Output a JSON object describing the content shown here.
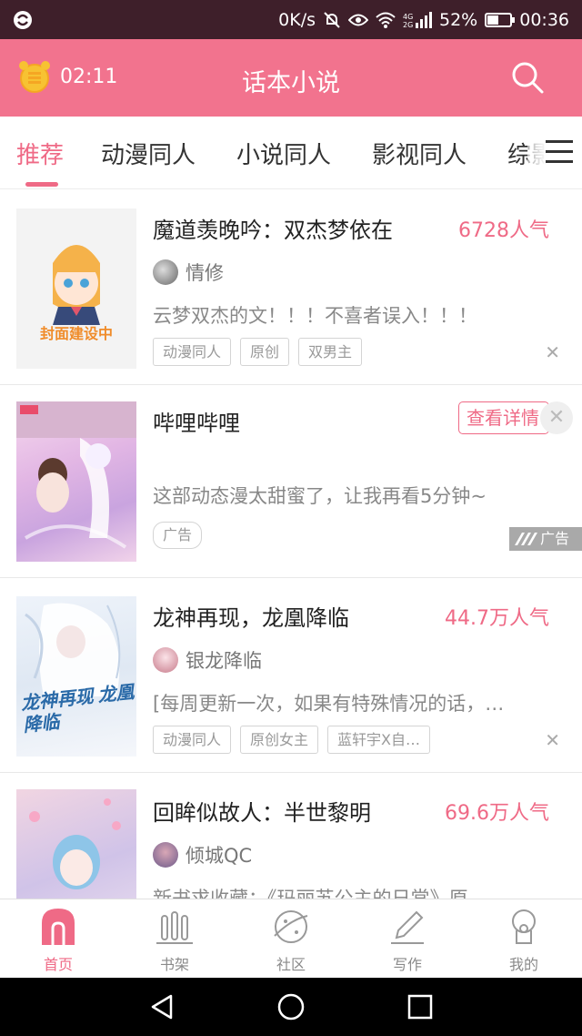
{
  "status_bar": {
    "speed": "0K/s",
    "network": "4G 2G",
    "battery": "52%",
    "battery_fraction": 0.52,
    "time": "00:36"
  },
  "header": {
    "timer": "02:11",
    "title": "话本小说"
  },
  "tabs": [
    {
      "label": "推荐",
      "active": true
    },
    {
      "label": "动漫同人",
      "active": false
    },
    {
      "label": "小说同人",
      "active": false
    },
    {
      "label": "影视同人",
      "active": false
    },
    {
      "label": "综影",
      "active": false
    }
  ],
  "feed": {
    "items": [
      {
        "title": "魔道羡晚吟：双杰梦依在",
        "popularity": "6728人气",
        "author": "情修",
        "description": "云梦双杰的文！！！不喜者误入！！！",
        "tags": [
          "动漫同人",
          "原创",
          "双男主"
        ],
        "cover_text": "封面建设中"
      },
      {
        "title": "哔哩哔哩",
        "ad_button": "查看详情",
        "description": "这部动态漫太甜蜜了，让我再看5分钟~",
        "ad_tag": "广告",
        "ad_mark": "广告"
      },
      {
        "title": "龙神再现，龙凰降临",
        "popularity": "44.7万人气",
        "author": "银龙降临",
        "description": "[每周更新一次，如果有特殊情况的话，…",
        "tags": [
          "动漫同人",
          "原创女主",
          "蓝轩宇X自…"
        ],
        "cover_text": "龙神再现 龙凰降临"
      },
      {
        "title": "回眸似故人：半世黎明",
        "popularity": "69.6万人气",
        "author": "倾城QC",
        "description": "新书求收藏：《玛丽苏公主的日常》原"
      }
    ]
  },
  "bottom_nav": [
    {
      "label": "首页",
      "icon": "home-icon",
      "active": true
    },
    {
      "label": "书架",
      "icon": "bookshelf-icon",
      "active": false
    },
    {
      "label": "社区",
      "icon": "community-planet-icon",
      "active": false
    },
    {
      "label": "写作",
      "icon": "pencil-icon",
      "active": false
    },
    {
      "label": "我的",
      "icon": "profile-icon",
      "active": false
    }
  ],
  "colors": {
    "accent": "#ef6a86",
    "header_bg": "#f2738e",
    "status_bg": "#3e1f2a"
  }
}
